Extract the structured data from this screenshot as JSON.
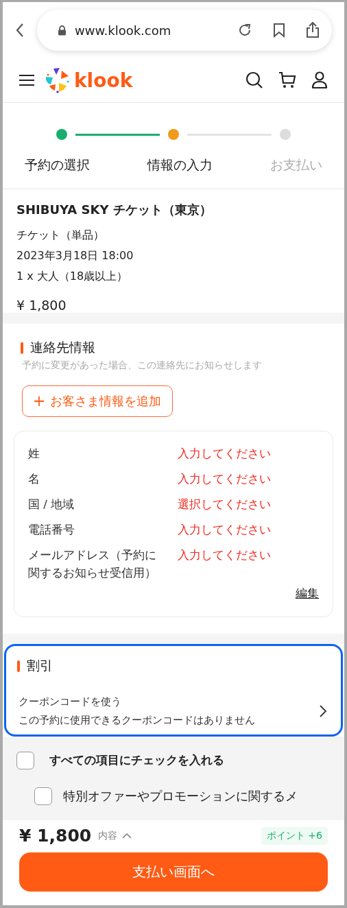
{
  "browser": {
    "url": "www.klook.com"
  },
  "header": {
    "logo_text": "klook"
  },
  "steps": [
    {
      "label": "予約の選択",
      "completed": true,
      "selected": false
    },
    {
      "label": "情報の入力",
      "completed": false,
      "selected": true
    },
    {
      "label": "お支払い",
      "completed": false,
      "selected": false
    }
  ],
  "product": {
    "title": "SHIBUYA SKY チケット（東京）",
    "lines": [
      "チケット（単品）",
      "2023年3月18日 18:00",
      "1 x 大人（18歳以上）"
    ],
    "price": "¥ 1,800"
  },
  "contact": {
    "title": "連絡先情報",
    "note": "予約に変更があった場合、この連絡先にお知らせします",
    "add_button": "お客さま情報を追加",
    "fields": [
      {
        "label": "姓",
        "value": "入力してください"
      },
      {
        "label": "名",
        "value": "入力してください"
      },
      {
        "label": "国 / 地域",
        "value": "選択してください"
      },
      {
        "label": "電話番号",
        "value": "入力してください"
      },
      {
        "label": "メールアドレス（予約に関するお知らせ受信用）",
        "value": "入力してください"
      }
    ],
    "edit_link": "編集"
  },
  "discount": {
    "title": "割引",
    "highlighted": true,
    "coupon_label": "クーポンコードを使う",
    "coupon_note": "この予約に使用できるクーポンコードはありません"
  },
  "consents": [
    {
      "kind": "all",
      "label": "すべての項目にチェックを入れる",
      "checked": false
    },
    {
      "kind": "item",
      "label": "特別オファーやプロモーションに関するメ",
      "checked": false
    }
  ],
  "footer": {
    "price": "¥ 1,800",
    "details_label": "内容",
    "points": "ポイント +6",
    "button": "支払い画面へ"
  }
}
